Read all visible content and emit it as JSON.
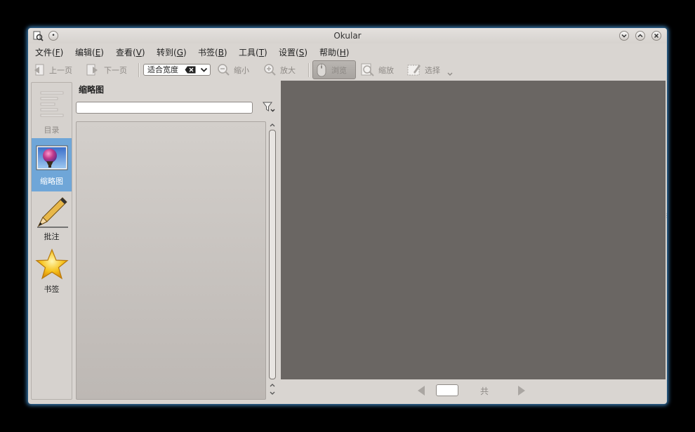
{
  "window": {
    "title": "Okular"
  },
  "menu": [
    {
      "label": "文件(",
      "key": "F",
      "suffix": ")"
    },
    {
      "label": "编辑(",
      "key": "E",
      "suffix": ")"
    },
    {
      "label": "查看(",
      "key": "V",
      "suffix": ")"
    },
    {
      "label": "转到(",
      "key": "G",
      "suffix": ")"
    },
    {
      "label": "书签(",
      "key": "B",
      "suffix": ")"
    },
    {
      "label": "工具(",
      "key": "T",
      "suffix": ")"
    },
    {
      "label": "设置(",
      "key": "S",
      "suffix": ")"
    },
    {
      "label": "帮助(",
      "key": "H",
      "suffix": ")"
    }
  ],
  "toolbar": {
    "prev_page": "上一页",
    "next_page": "下一页",
    "zoom_mode": "适合宽度",
    "zoom_out": "缩小",
    "zoom_in": "放大",
    "browse": "浏览",
    "zoom_tool": "缩放",
    "select_tool": "选择"
  },
  "sidebar": {
    "tabs": [
      {
        "label": "目录"
      },
      {
        "label": "缩略图"
      },
      {
        "label": "批注"
      },
      {
        "label": "书签"
      }
    ],
    "active_index": 1
  },
  "panel": {
    "title": "缩略图",
    "search_value": ""
  },
  "pagebar": {
    "current_page": "",
    "of_label": "共"
  },
  "colors": {
    "accent": "#6fa6d8",
    "viewer_bg": "#6a6663",
    "window_bg": "#d9d5d1"
  }
}
